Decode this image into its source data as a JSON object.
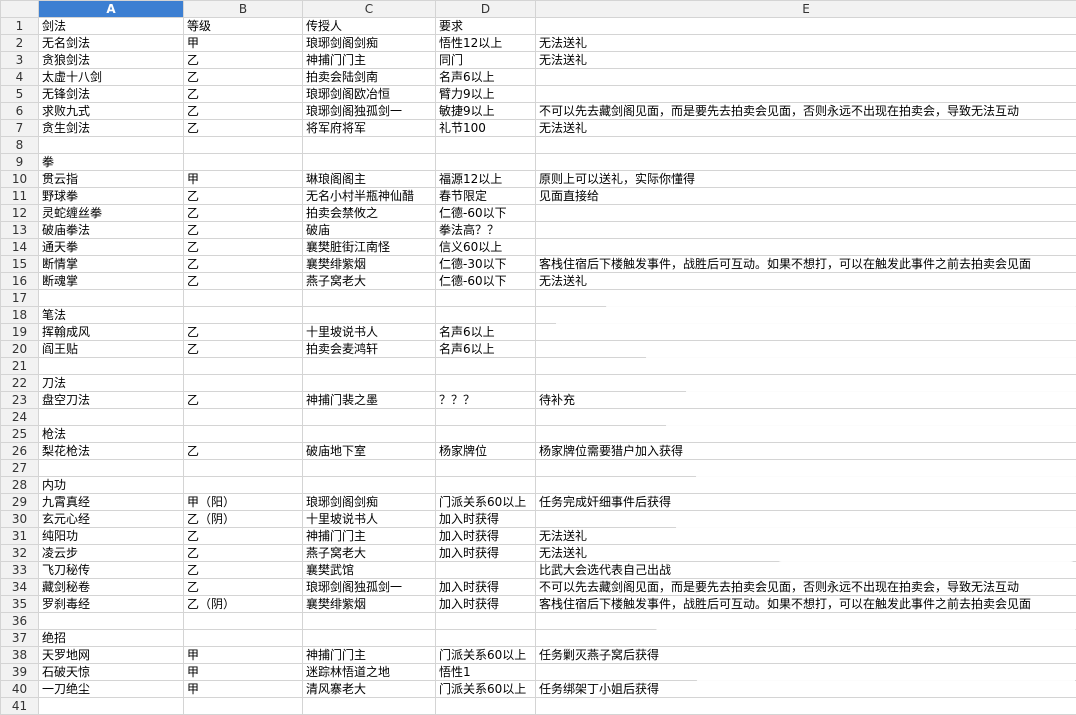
{
  "columns": [
    "A",
    "B",
    "C",
    "D",
    "E"
  ],
  "selected_column": "A",
  "rows": [
    [
      "剑法",
      "等级",
      "传授人",
      "要求",
      ""
    ],
    [
      "无名剑法",
      "甲",
      "琅琊剑阁剑痴",
      "悟性12以上",
      "无法送礼"
    ],
    [
      "贪狼剑法",
      "乙",
      "神捕门门主",
      "同门",
      "无法送礼"
    ],
    [
      "太虚十八剑",
      "乙",
      "拍卖会陆剑南",
      "名声6以上",
      ""
    ],
    [
      "无锋剑法",
      "乙",
      "琅琊剑阁欧冶恒",
      "臂力9以上",
      ""
    ],
    [
      "求败九式",
      "乙",
      "琅琊剑阁独孤剑一",
      "敏捷9以上",
      "不可以先去藏剑阁见面，而是要先去拍卖会见面，否则永远不出现在拍卖会，导致无法互动"
    ],
    [
      "贪生剑法",
      "乙",
      "将军府将军",
      "礼节100",
      "无法送礼"
    ],
    [
      "",
      "",
      "",
      "",
      ""
    ],
    [
      "拳",
      "",
      "",
      "",
      ""
    ],
    [
      "贯云指",
      "甲",
      "琳琅阁阁主",
      "福源12以上",
      "原则上可以送礼，实际你懂得"
    ],
    [
      "野球拳",
      "乙",
      "无名小村半瓶神仙醋",
      "春节限定",
      "见面直接给"
    ],
    [
      "灵蛇缠丝拳",
      "乙",
      "拍卖会禁攸之",
      "仁德-60以下",
      ""
    ],
    [
      "破庙拳法",
      "乙",
      "破庙",
      "拳法高？？",
      ""
    ],
    [
      "通天拳",
      "乙",
      "襄樊脏街江南怪",
      "信义60以上",
      ""
    ],
    [
      "断情掌",
      "乙",
      "襄樊绯紫烟",
      "仁德-30以下",
      "客栈住宿后下楼触发事件，战胜后可互动。如果不想打，可以在触发此事件之前去拍卖会见面"
    ],
    [
      "断魂掌",
      "乙",
      "燕子窝老大",
      "仁德-60以下",
      "无法送礼"
    ],
    [
      "",
      "",
      "",
      "",
      ""
    ],
    [
      "笔法",
      "",
      "",
      "",
      ""
    ],
    [
      "挥翰成风",
      "乙",
      "十里坡说书人",
      "名声6以上",
      ""
    ],
    [
      "阎王贴",
      "乙",
      "拍卖会麦鸿轩",
      "名声6以上",
      ""
    ],
    [
      "",
      "",
      "",
      "",
      ""
    ],
    [
      "刀法",
      "",
      "",
      "",
      ""
    ],
    [
      "盘空刀法",
      "乙",
      "神捕门裴之墨",
      "？？？",
      "待补充"
    ],
    [
      "",
      "",
      "",
      "",
      ""
    ],
    [
      "枪法",
      "",
      "",
      "",
      ""
    ],
    [
      "梨花枪法",
      "乙",
      "破庙地下室",
      "杨家牌位",
      "杨家牌位需要猎户加入获得"
    ],
    [
      "",
      "",
      "",
      "",
      ""
    ],
    [
      "内功",
      "",
      "",
      "",
      ""
    ],
    [
      "九霄真经",
      "甲（阳）",
      "琅琊剑阁剑痴",
      "门派关系60以上",
      "任务完成奸细事件后获得"
    ],
    [
      "玄元心经",
      "乙（阴）",
      "十里坡说书人",
      "加入时获得",
      ""
    ],
    [
      "纯阳功",
      "乙",
      "神捕门门主",
      "加入时获得",
      "无法送礼"
    ],
    [
      "凌云步",
      "乙",
      "燕子窝老大",
      "加入时获得",
      "无法送礼"
    ],
    [
      "飞刀秘传",
      "乙",
      "襄樊武馆",
      "",
      "比武大会选代表自己出战"
    ],
    [
      "藏剑秘卷",
      "乙",
      "琅琊剑阁独孤剑一",
      "加入时获得",
      "不可以先去藏剑阁见面，而是要先去拍卖会见面，否则永远不出现在拍卖会，导致无法互动"
    ],
    [
      "罗刹毒经",
      "乙（阴）",
      "襄樊绯紫烟",
      "加入时获得",
      "客栈住宿后下楼触发事件，战胜后可互动。如果不想打，可以在触发此事件之前去拍卖会见面"
    ],
    [
      "",
      "",
      "",
      "",
      ""
    ],
    [
      "绝招",
      "",
      "",
      "",
      ""
    ],
    [
      "天罗地网",
      "甲",
      "神捕门门主",
      "门派关系60以上",
      "任务剿灭燕子窝后获得"
    ],
    [
      "石破天惊",
      "甲",
      "迷踪林悟道之地",
      "悟性1",
      ""
    ],
    [
      "一刀绝尘",
      "甲",
      "清风寨老大",
      "门派关系60以上",
      "任务绑架丁小姐后获得"
    ],
    [
      "",
      "",
      "",
      "",
      ""
    ]
  ]
}
